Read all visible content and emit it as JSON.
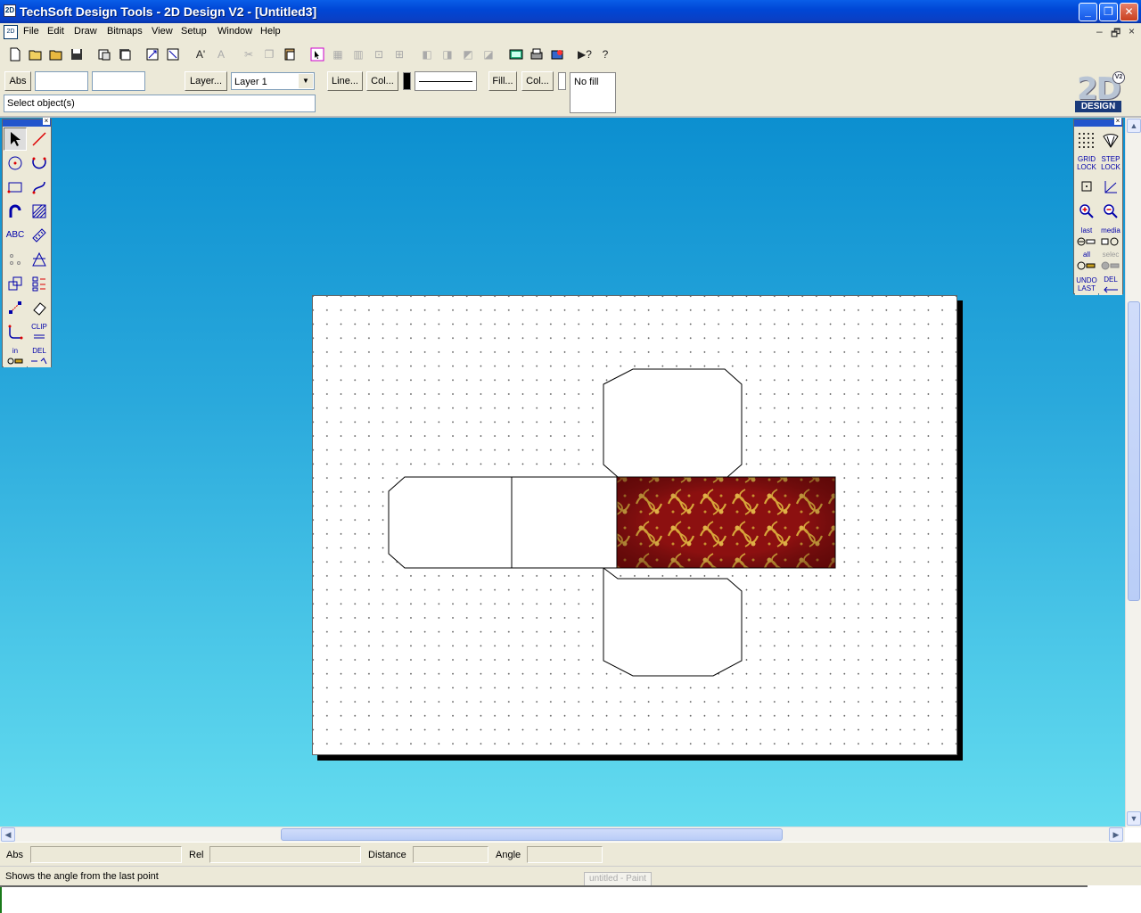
{
  "window": {
    "title": "TechSoft Design Tools - 2D Design V2 - [Untitled3]",
    "app_icon": "2D",
    "minimize": "_",
    "maximize": "❐",
    "close": "✕"
  },
  "menu": {
    "items": [
      "File",
      "Edit",
      "Draw",
      "Bitmaps",
      "View",
      "Setup",
      "Window",
      "Help"
    ],
    "mdi_controls": [
      "–",
      "🗗",
      "×"
    ]
  },
  "toolbar": {
    "abs_label": "Abs",
    "x_value": "",
    "y_value": "",
    "layer_button": "Layer...",
    "layer_select": "Layer 1",
    "line_button": "Line...",
    "line_col_button": "Col...",
    "fill_button": "Fill...",
    "fill_col_button": "Col...",
    "fill_value": "No fill",
    "prompt": "Select object(s)"
  },
  "logo": {
    "text": "2D",
    "badge": "V2",
    "sub": "DESIGN"
  },
  "left_palette_labels": {
    "text_tool": "ABC",
    "clip": "CLIP",
    "in": "in",
    "del": "DEL"
  },
  "right_palette_labels": {
    "grid_lock": [
      "GRID",
      "LOCK"
    ],
    "step_lock": [
      "STEP",
      "LOCK"
    ],
    "last": "last",
    "media": "media",
    "all": "all",
    "selec": "selec",
    "undo_last": [
      "UNDO",
      "LAST"
    ],
    "del": "DEL"
  },
  "coords": {
    "abs_label": "Abs",
    "rel_label": "Rel",
    "distance_label": "Distance",
    "angle_label": "Angle"
  },
  "status": {
    "text": "Shows the angle from the last point",
    "ghost_window": "untitled - Paint"
  },
  "colors": {
    "title_blue": "#0047d6",
    "canvas_top": "#0c8fd0",
    "canvas_bottom": "#64dcef",
    "pattern_red": "#8c1010",
    "pattern_gold": "#d8a63a"
  }
}
